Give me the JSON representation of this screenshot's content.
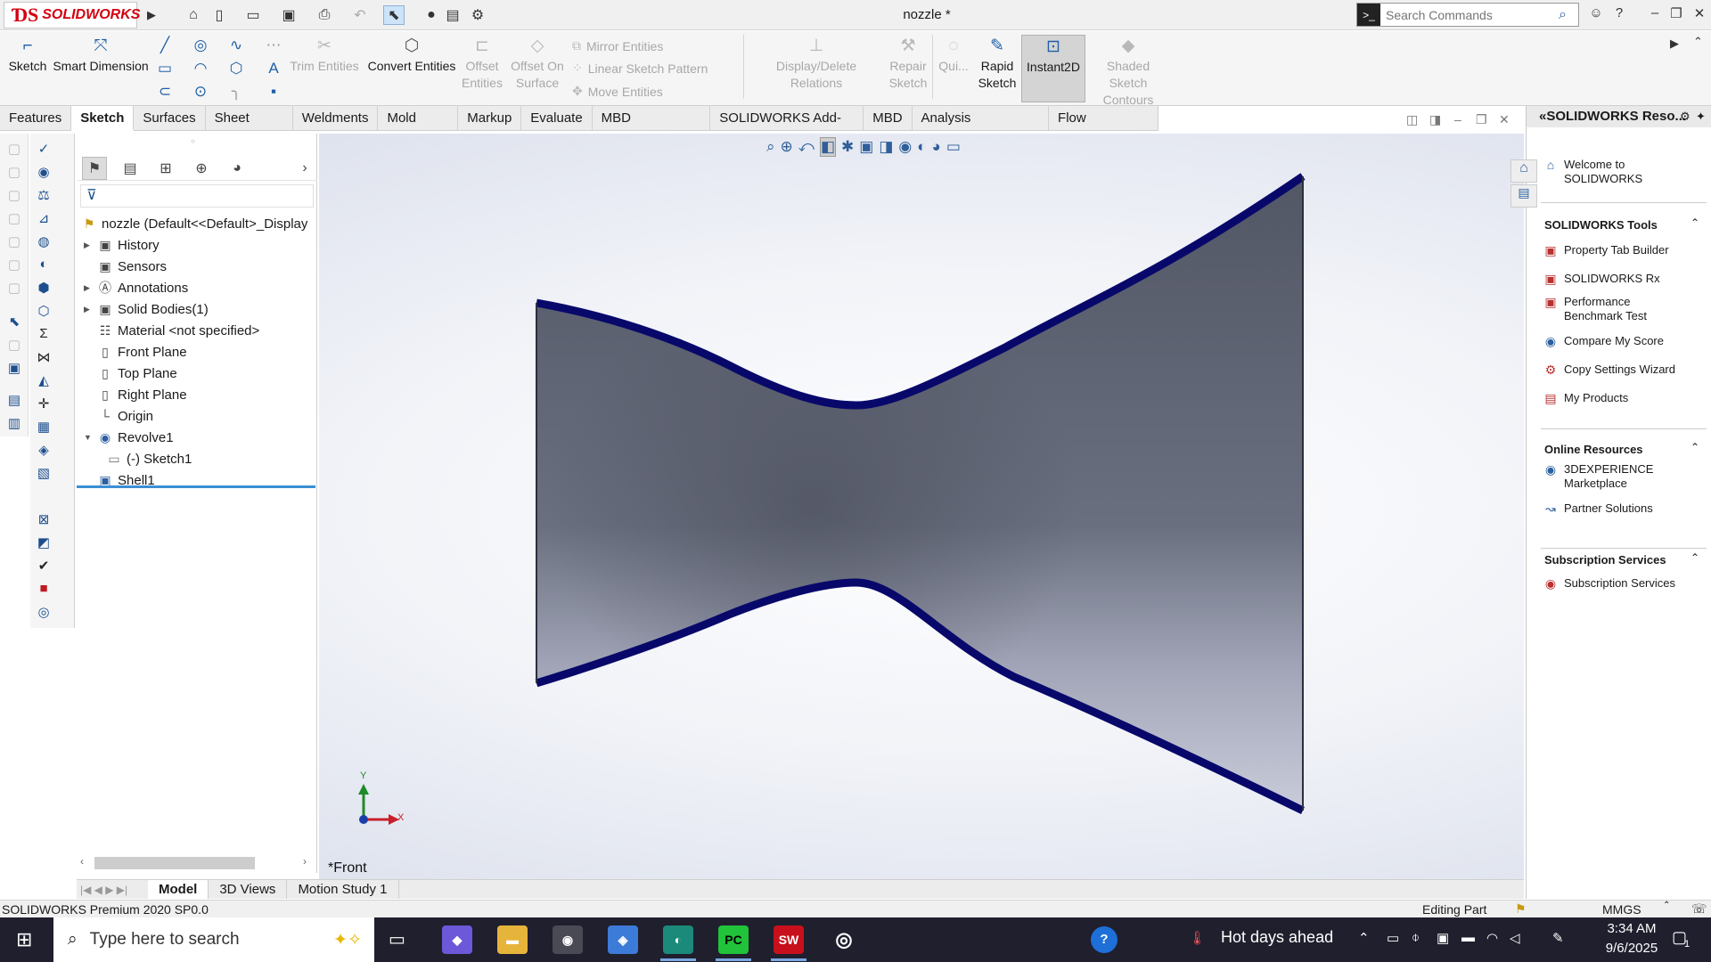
{
  "app": {
    "logo_text": "SOLIDWORKS",
    "document_title": "nozzle *"
  },
  "search": {
    "placeholder": "Search Commands"
  },
  "sketch_tools": {
    "sketch": "Sketch",
    "smart_dimension": "Smart Dimension",
    "trim_entities": "Trim Entities",
    "convert_entities": "Convert Entities",
    "offset_entities": "Offset Entities",
    "offset_on_surface": "Offset On Surface",
    "mirror_entities": "Mirror Entities",
    "linear_sketch_pattern": "Linear Sketch Pattern",
    "move_entities": "Move Entities",
    "display_delete_relations": "Display/Delete Relations",
    "repair_sketch": "Repair Sketch",
    "quick_snaps": "Qui...",
    "rapid_sketch": "Rapid Sketch",
    "instant2d": "Instant2D",
    "shaded_sketch_contours": "Shaded Sketch Contours"
  },
  "tabs": [
    "Features",
    "Sketch",
    "Surfaces",
    "Sheet Metal",
    "Weldments",
    "Mold Tools",
    "Markup",
    "Evaluate",
    "MBD Dimensions",
    "SOLIDWORKS Add-Ins",
    "MBD",
    "Analysis Preparation",
    "Flow Simulation"
  ],
  "tree": {
    "root": "nozzle  (Default<<Default>_Display",
    "history": "History",
    "sensors": "Sensors",
    "annotations": "Annotations",
    "solid_bodies": "Solid Bodies(1)",
    "material": "Material <not specified>",
    "front_plane": "Front Plane",
    "top_plane": "Top Plane",
    "right_plane": "Right Plane",
    "origin": "Origin",
    "revolve1": "Revolve1",
    "sketch1": "(-) Sketch1",
    "shell1": "Shell1"
  },
  "viewport": {
    "view_label": "*Front",
    "axis_x": "X",
    "axis_y": "Y"
  },
  "bottom_tabs": [
    "Model",
    "3D Views",
    "Motion Study 1"
  ],
  "status": {
    "product": "SOLIDWORKS Premium 2020 SP0.0",
    "mode": "Editing Part",
    "units": "MMGS"
  },
  "task_pane": {
    "title": "SOLIDWORKS Reso...",
    "welcome": "Welcome to SOLIDWORKS",
    "section_tools": "SOLIDWORKS Tools",
    "tools": [
      "Property Tab Builder",
      "SOLIDWORKS Rx",
      "Performance Benchmark Test",
      "Compare My Score",
      "Copy Settings Wizard",
      "My Products"
    ],
    "section_online": "Online Resources",
    "online": [
      "3DEXPERIENCE Marketplace",
      "Partner Solutions"
    ],
    "section_subscription": "Subscription Services",
    "subscription": [
      "Subscription Services"
    ]
  },
  "taskbar": {
    "search_placeholder": "Type here to search",
    "weather": "Hot days ahead",
    "time": "3:34 AM",
    "date": "9/6/2025",
    "notifications": "1",
    "apps": [
      "PC",
      "SW"
    ]
  },
  "colors": {
    "accent": "#1e5fa8",
    "brand_red": "#d4000f",
    "model_edge": "#08086b",
    "model_face": "#5d6274"
  }
}
